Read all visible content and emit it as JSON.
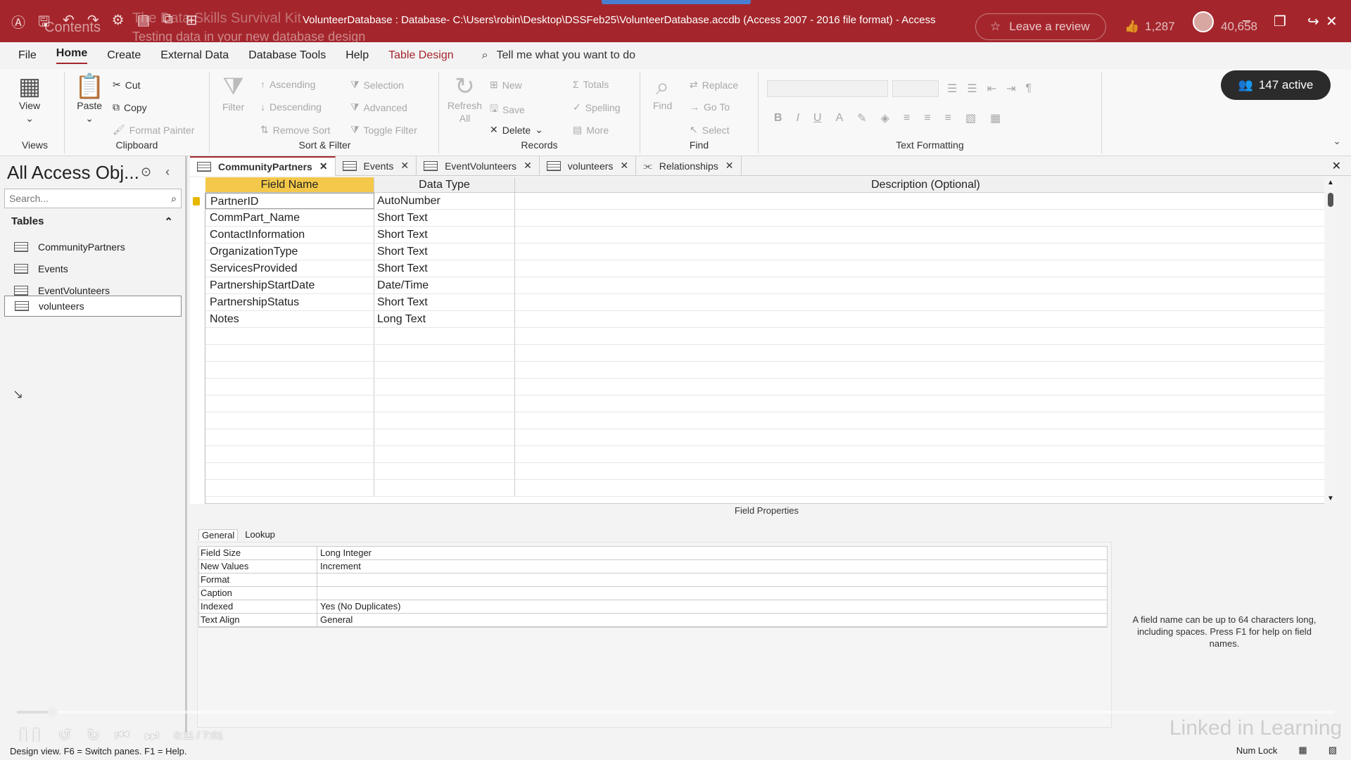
{
  "titlebar": {
    "title": "VolunteerDatabase : Database- C:\\Users\\robin\\Desktop\\DSSFeb25\\VolunteerDatabase.accdb (Access 2007 - 2016 file format)  -  Access",
    "overlay_contents": "Contents",
    "overlay_course": "The Data Skills Survival Kit",
    "overlay_chapter": "Testing data in your new database design",
    "review_label": "Leave a review",
    "likes": "1,287",
    "views": "40,658"
  },
  "menu": {
    "tabs": [
      "File",
      "Home",
      "Create",
      "External Data",
      "Database Tools",
      "Help",
      "Table Design"
    ],
    "tell_me": "Tell me what you want to do"
  },
  "ribbon": {
    "views": {
      "view": "View",
      "label": "Views"
    },
    "clipboard": {
      "paste": "Paste",
      "cut": "Cut",
      "copy": "Copy",
      "format_painter": "Format Painter",
      "label": "Clipboard"
    },
    "sort_filter": {
      "filter": "Filter",
      "ascending": "Ascending",
      "descending": "Descending",
      "remove_sort": "Remove Sort",
      "selection": "Selection",
      "advanced": "Advanced",
      "toggle_filter": "Toggle Filter",
      "label": "Sort & Filter"
    },
    "records": {
      "refresh": "Refresh",
      "all": "All",
      "new": "New",
      "save": "Save",
      "delete": "Delete",
      "totals": "Totals",
      "spelling": "Spelling",
      "more": "More",
      "label": "Records"
    },
    "find": {
      "find": "Find",
      "replace": "Replace",
      "go_to": "Go To",
      "select": "Select",
      "label": "Find"
    },
    "text_formatting": {
      "label": "Text Formatting"
    },
    "active_label": "147 active"
  },
  "nav": {
    "title": "All Access Obj...",
    "search_placeholder": "Search...",
    "section": "Tables",
    "tables": [
      "CommunityPartners",
      "Events",
      "EventVolunteers",
      "volunteers"
    ]
  },
  "doctabs": [
    "CommunityPartners",
    "Events",
    "EventVolunteers",
    "volunteers",
    "Relationships"
  ],
  "grid": {
    "headers": {
      "field": "Field Name",
      "type": "Data Type",
      "desc": "Description (Optional)"
    },
    "rows": [
      {
        "field": "PartnerID",
        "type": "AutoNumber"
      },
      {
        "field": "CommPart_Name",
        "type": "Short Text"
      },
      {
        "field": "ContactInformation",
        "type": "Short Text"
      },
      {
        "field": "OrganizationType",
        "type": "Short Text"
      },
      {
        "field": "ServicesProvided",
        "type": "Short Text"
      },
      {
        "field": "PartnershipStartDate",
        "type": "Date/Time"
      },
      {
        "field": "PartnershipStatus",
        "type": "Short Text"
      },
      {
        "field": "Notes",
        "type": "Long Text"
      }
    ]
  },
  "field_properties": {
    "label": "Field Properties",
    "tabs": [
      "General",
      "Lookup"
    ],
    "props": [
      {
        "k": "Field Size",
        "v": "Long Integer"
      },
      {
        "k": "New Values",
        "v": "Increment"
      },
      {
        "k": "Format",
        "v": ""
      },
      {
        "k": "Caption",
        "v": ""
      },
      {
        "k": "Indexed",
        "v": "Yes (No Duplicates)"
      },
      {
        "k": "Text Align",
        "v": "General"
      }
    ],
    "help": "A field name can be up to 64 characters long, including spaces. Press F1 for help on field names."
  },
  "video": {
    "time": "0:11 / 7:01",
    "watermark": "Linked in Learning"
  },
  "status": {
    "left": "Design view.  F6 = Switch panes.  F1 = Help.",
    "numlock": "Num Lock"
  },
  "colors": {
    "accent": "#a4262c",
    "field_header": "#f4c84a"
  }
}
